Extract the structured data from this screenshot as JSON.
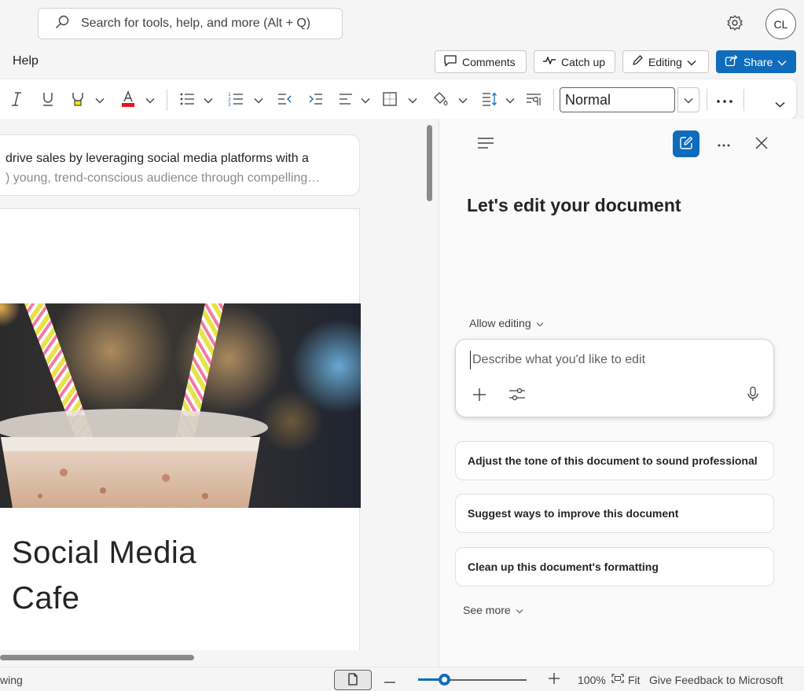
{
  "topbar": {
    "search_placeholder": "Search for tools, help, and more (Alt + Q)",
    "avatar_initials": "CL"
  },
  "ribbon": {
    "help_tab": "Help",
    "comments": "Comments",
    "catch_up": "Catch up",
    "editing": "Editing",
    "share": "Share"
  },
  "toolbar": {
    "style_value": "Normal"
  },
  "document": {
    "summary_line1": "drive sales by leveraging social media platforms with a",
    "summary_line2": ") young, trend-conscious audience through compelling…",
    "title_line1": "Social Media",
    "title_line2": "Cafe"
  },
  "copilot": {
    "heading": "Let's edit your document",
    "allow_editing": "Allow editing",
    "prompt_placeholder": "Describe what you'd like to edit",
    "suggestions": [
      "Adjust the tone of this document to sound professional",
      "Suggest ways to improve this document",
      "Clean up this document's formatting"
    ],
    "see_more": "See more"
  },
  "statusbar": {
    "left_text": "wing",
    "zoom_level": "100%",
    "zoom_fraction": 0.24,
    "fit": "Fit",
    "feedback": "Give Feedback to Microsoft"
  },
  "colors": {
    "accent": "#0f6cbd",
    "font_color_red": "#e81123",
    "highlight_yellow": "#ffe500"
  }
}
